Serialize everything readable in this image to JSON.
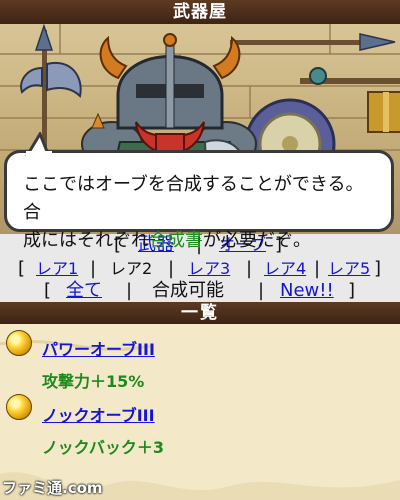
{
  "header": {
    "title": "武器屋"
  },
  "dialog": {
    "line1": "ここではオーブを合成することができる。合",
    "line2_a": "成にはそれぞれ",
    "line2_highlight": "合成書",
    "line2_b": "が必要だぞ。"
  },
  "menu": {
    "row1": {
      "open": "[",
      "weapon": "武器",
      "sep": "|",
      "orb": "オーブ",
      "close": "]"
    },
    "row2": {
      "open": "[",
      "r1": "レア1",
      "r2": "レア2",
      "r3": "レア3",
      "r4": "レア4",
      "r5": "レア5",
      "sep": "|",
      "close": "]"
    },
    "row3": {
      "open": "[",
      "all": "全て",
      "craftable": "合成可能",
      "new": "New!!",
      "sep": "|",
      "close": "]"
    }
  },
  "list": {
    "header": "一覧",
    "items": [
      {
        "name": "パワーオーブIII",
        "effect": "攻撃力＋15%"
      },
      {
        "name": "ノックオーブIII",
        "effect": "ノックバック＋3"
      }
    ]
  },
  "watermark": "ファミ通.com",
  "colors": {
    "link": "#1515d6",
    "highlight": "#1d8f1d",
    "header_bg": "#4a2c18",
    "menu_bg": "#e9e9e9"
  }
}
